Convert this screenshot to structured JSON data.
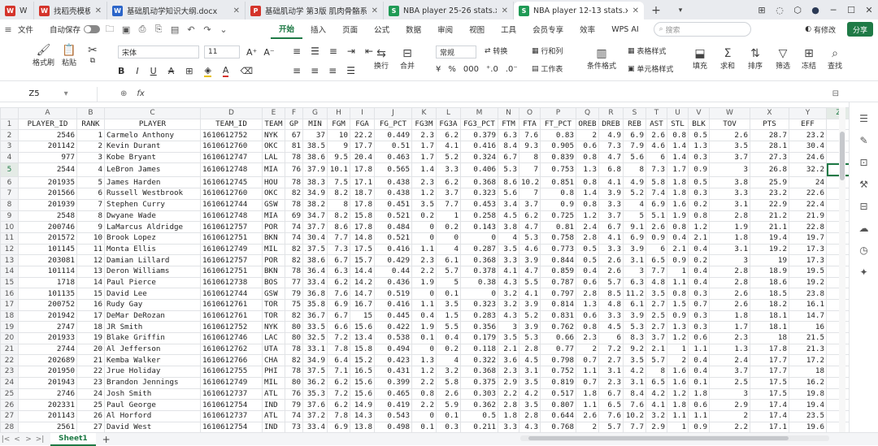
{
  "tabs": [
    {
      "label": "W",
      "color": "#d4342b",
      "icon": "W"
    },
    {
      "label": "找稻壳模板",
      "color": "#d4342b",
      "icon": "W"
    },
    {
      "label": "基础肌动学知识大纲.docx",
      "color": "#2b65c9",
      "icon": "W"
    },
    {
      "label": "基础肌动学 第3版 肌肉骨骼系统结构",
      "color": "#d4342b",
      "icon": "P"
    },
    {
      "label": "NBA player 25-26 stats.xlsx",
      "color": "#1f9a55",
      "icon": "S"
    },
    {
      "label": "NBA player 12-13 stats.xlsx",
      "color": "#1f9a55",
      "icon": "S"
    }
  ],
  "menubar": {
    "file": "文件",
    "autosave": "自动保存",
    "items": [
      "开始",
      "插入",
      "页面",
      "公式",
      "数据",
      "审阅",
      "视图",
      "工具",
      "会员专享",
      "效率",
      "WPS AI"
    ],
    "active": "开始",
    "search_placeholder": "搜索",
    "modify": "有修改",
    "share": "分享"
  },
  "ribbon": {
    "format_painter": "格式刷",
    "paste": "粘贴",
    "font": "宋体",
    "size": "11",
    "wrap": "换行",
    "merge": "合并",
    "number_format": "常规",
    "convert": "转换",
    "rowcol": "行和列",
    "worksheet": "工作表",
    "cond_format": "条件格式",
    "table_style": "表格样式",
    "cell_style": "单元格样式",
    "fill": "填充",
    "sum": "求和",
    "sort": "排序",
    "filter": "筛选",
    "freeze": "冻结",
    "find": "查找"
  },
  "formula": {
    "cell": "Z5",
    "fx": "fx"
  },
  "columns": [
    "A",
    "B",
    "C",
    "D",
    "E",
    "F",
    "G",
    "H",
    "I",
    "J",
    "K",
    "L",
    "M",
    "N",
    "O",
    "P",
    "Q",
    "R",
    "S",
    "T",
    "U",
    "V",
    "W",
    "X",
    "Y",
    "Z"
  ],
  "headers": [
    "PLAYER_ID",
    "RANK",
    "PLAYER",
    "TEAM_ID",
    "TEAM",
    "GP",
    "MIN",
    "FGM",
    "FGA",
    "FG_PCT",
    "FG3M",
    "FG3A",
    "FG3_PCT",
    "FTM",
    "FTA",
    "FT_PCT",
    "OREB",
    "DREB",
    "REB",
    "AST",
    "STL",
    "BLK",
    "TOV",
    "PTS",
    "EFF",
    ""
  ],
  "rows": [
    [
      "2546",
      "1",
      "Carmelo Anthony",
      "1610612752",
      "NYK",
      "67",
      "37",
      "10",
      "22.2",
      "0.449",
      "2.3",
      "6.2",
      "0.379",
      "6.3",
      "7.6",
      "0.83",
      "2",
      "4.9",
      "6.9",
      "2.6",
      "0.8",
      "0.5",
      "2.6",
      "28.7",
      "23.2"
    ],
    [
      "201142",
      "2",
      "Kevin Durant",
      "1610612760",
      "OKC",
      "81",
      "38.5",
      "9",
      "17.7",
      "0.51",
      "1.7",
      "4.1",
      "0.416",
      "8.4",
      "9.3",
      "0.905",
      "0.6",
      "7.3",
      "7.9",
      "4.6",
      "1.4",
      "1.3",
      "3.5",
      "28.1",
      "30.4"
    ],
    [
      "977",
      "3",
      "Kobe Bryant",
      "1610612747",
      "LAL",
      "78",
      "38.6",
      "9.5",
      "20.4",
      "0.463",
      "1.7",
      "5.2",
      "0.324",
      "6.7",
      "8",
      "0.839",
      "0.8",
      "4.7",
      "5.6",
      "6",
      "1.4",
      "0.3",
      "3.7",
      "27.3",
      "24.6"
    ],
    [
      "2544",
      "4",
      "LeBron James",
      "1610612748",
      "MIA",
      "76",
      "37.9",
      "10.1",
      "17.8",
      "0.565",
      "1.4",
      "3.3",
      "0.406",
      "5.3",
      "7",
      "0.753",
      "1.3",
      "6.8",
      "8",
      "7.3",
      "1.7",
      "0.9",
      "3",
      "26.8",
      "32.2"
    ],
    [
      "201935",
      "5",
      "James Harden",
      "1610612745",
      "HOU",
      "78",
      "38.3",
      "7.5",
      "17.1",
      "0.438",
      "2.3",
      "6.2",
      "0.368",
      "8.6",
      "10.2",
      "0.851",
      "0.8",
      "4.1",
      "4.9",
      "5.8",
      "1.8",
      "0.5",
      "3.8",
      "25.9",
      "24"
    ],
    [
      "201566",
      "6",
      "Russell Westbrook",
      "1610612760",
      "OKC",
      "82",
      "34.9",
      "8.2",
      "18.7",
      "0.438",
      "1.2",
      "3.7",
      "0.323",
      "5.6",
      "7",
      "0.8",
      "1.4",
      "3.9",
      "5.2",
      "7.4",
      "1.8",
      "0.3",
      "3.3",
      "23.2",
      "22.6"
    ],
    [
      "201939",
      "7",
      "Stephen Curry",
      "1610612744",
      "GSW",
      "78",
      "38.2",
      "8",
      "17.8",
      "0.451",
      "3.5",
      "7.7",
      "0.453",
      "3.4",
      "3.7",
      "0.9",
      "0.8",
      "3.3",
      "4",
      "6.9",
      "1.6",
      "0.2",
      "3.1",
      "22.9",
      "22.4"
    ],
    [
      "2548",
      "8",
      "Dwyane Wade",
      "1610612748",
      "MIA",
      "69",
      "34.7",
      "8.2",
      "15.8",
      "0.521",
      "0.2",
      "1",
      "0.258",
      "4.5",
      "6.2",
      "0.725",
      "1.2",
      "3.7",
      "5",
      "5.1",
      "1.9",
      "0.8",
      "2.8",
      "21.2",
      "21.9"
    ],
    [
      "200746",
      "9",
      "LaMarcus Aldridge",
      "1610612757",
      "POR",
      "74",
      "37.7",
      "8.6",
      "17.8",
      "0.484",
      "0",
      "0.2",
      "0.143",
      "3.8",
      "4.7",
      "0.81",
      "2.4",
      "6.7",
      "9.1",
      "2.6",
      "0.8",
      "1.2",
      "1.9",
      "21.1",
      "22.8"
    ],
    [
      "201572",
      "10",
      "Brook Lopez",
      "1610612751",
      "BKN",
      "74",
      "30.4",
      "7.7",
      "14.8",
      "0.521",
      "0",
      "0",
      "0",
      "4",
      "5.3",
      "0.758",
      "2.8",
      "4.1",
      "6.9",
      "0.9",
      "0.4",
      "2.1",
      "1.8",
      "19.4",
      "19.7"
    ],
    [
      "101145",
      "11",
      "Monta Ellis",
      "1610612749",
      "MIL",
      "82",
      "37.5",
      "7.3",
      "17.5",
      "0.416",
      "1.1",
      "4",
      "0.287",
      "3.5",
      "4.6",
      "0.773",
      "0.5",
      "3.3",
      "3.9",
      "6",
      "2.1",
      "0.4",
      "3.1",
      "19.2",
      "17.3"
    ],
    [
      "203081",
      "12",
      "Damian Lillard",
      "1610612757",
      "POR",
      "82",
      "38.6",
      "6.7",
      "15.7",
      "0.429",
      "2.3",
      "6.1",
      "0.368",
      "3.3",
      "3.9",
      "0.844",
      "0.5",
      "2.6",
      "3.1",
      "6.5",
      "0.9",
      "0.2",
      "3",
      "19",
      "17.3"
    ],
    [
      "101114",
      "13",
      "Deron Williams",
      "1610612751",
      "BKN",
      "78",
      "36.4",
      "6.3",
      "14.4",
      "0.44",
      "2.2",
      "5.7",
      "0.378",
      "4.1",
      "4.7",
      "0.859",
      "0.4",
      "2.6",
      "3",
      "7.7",
      "1",
      "0.4",
      "2.8",
      "18.9",
      "19.5"
    ],
    [
      "1718",
      "14",
      "Paul Pierce",
      "1610612738",
      "BOS",
      "77",
      "33.4",
      "6.2",
      "14.2",
      "0.436",
      "1.9",
      "5",
      "0.38",
      "4.3",
      "5.5",
      "0.787",
      "0.6",
      "5.7",
      "6.3",
      "4.8",
      "1.1",
      "0.4",
      "2.8",
      "18.6",
      "19.2"
    ],
    [
      "101135",
      "15",
      "David Lee",
      "1610612744",
      "GSW",
      "79",
      "36.8",
      "7.6",
      "14.7",
      "0.519",
      "0",
      "0.1",
      "0",
      "3.2",
      "4.1",
      "0.797",
      "2.8",
      "8.5",
      "11.2",
      "3.5",
      "0.8",
      "0.3",
      "2.6",
      "18.5",
      "23.8"
    ],
    [
      "200752",
      "16",
      "Rudy Gay",
      "1610612761",
      "TOR",
      "75",
      "35.8",
      "6.9",
      "16.7",
      "0.416",
      "1.1",
      "3.5",
      "0.323",
      "3.2",
      "3.9",
      "0.814",
      "1.3",
      "4.8",
      "6.1",
      "2.7",
      "1.5",
      "0.7",
      "2.6",
      "18.2",
      "16.1"
    ],
    [
      "201942",
      "17",
      "DeMar DeRozan",
      "1610612761",
      "TOR",
      "82",
      "36.7",
      "6.7",
      "15",
      "0.445",
      "0.4",
      "1.5",
      "0.283",
      "4.3",
      "5.2",
      "0.831",
      "0.6",
      "3.3",
      "3.9",
      "2.5",
      "0.9",
      "0.3",
      "1.8",
      "18.1",
      "14.7"
    ],
    [
      "2747",
      "18",
      "JR Smith",
      "1610612752",
      "NYK",
      "80",
      "33.5",
      "6.6",
      "15.6",
      "0.422",
      "1.9",
      "5.5",
      "0.356",
      "3",
      "3.9",
      "0.762",
      "0.8",
      "4.5",
      "5.3",
      "2.7",
      "1.3",
      "0.3",
      "1.7",
      "18.1",
      "16"
    ],
    [
      "201933",
      "19",
      "Blake Griffin",
      "1610612746",
      "LAC",
      "80",
      "32.5",
      "7.2",
      "13.4",
      "0.538",
      "0.1",
      "0.4",
      "0.179",
      "3.5",
      "5.3",
      "0.66",
      "2.3",
      "6",
      "8.3",
      "3.7",
      "1.2",
      "0.6",
      "2.3",
      "18",
      "21.5"
    ],
    [
      "2744",
      "20",
      "Al Jefferson",
      "1610612762",
      "UTA",
      "78",
      "33.1",
      "7.8",
      "15.8",
      "0.494",
      "0",
      "0.2",
      "0.118",
      "2.1",
      "2.8",
      "0.77",
      "2",
      "7.2",
      "9.2",
      "2.1",
      "1",
      "1.1",
      "1.3",
      "17.8",
      "21.3"
    ],
    [
      "202689",
      "21",
      "Kemba Walker",
      "1610612766",
      "CHA",
      "82",
      "34.9",
      "6.4",
      "15.2",
      "0.423",
      "1.3",
      "4",
      "0.322",
      "3.6",
      "4.5",
      "0.798",
      "0.7",
      "2.7",
      "3.5",
      "5.7",
      "2",
      "0.4",
      "2.4",
      "17.7",
      "17.2"
    ],
    [
      "201950",
      "22",
      "Jrue Holiday",
      "1610612755",
      "PHI",
      "78",
      "37.5",
      "7.1",
      "16.5",
      "0.431",
      "1.2",
      "3.2",
      "0.368",
      "2.3",
      "3.1",
      "0.752",
      "1.1",
      "3.1",
      "4.2",
      "8",
      "1.6",
      "0.4",
      "3.7",
      "17.7",
      "18"
    ],
    [
      "201943",
      "23",
      "Brandon Jennings",
      "1610612749",
      "MIL",
      "80",
      "36.2",
      "6.2",
      "15.6",
      "0.399",
      "2.2",
      "5.8",
      "0.375",
      "2.9",
      "3.5",
      "0.819",
      "0.7",
      "2.3",
      "3.1",
      "6.5",
      "1.6",
      "0.1",
      "2.5",
      "17.5",
      "16.2"
    ],
    [
      "2746",
      "24",
      "Josh Smith",
      "1610612737",
      "ATL",
      "76",
      "35.3",
      "7.2",
      "15.6",
      "0.465",
      "0.8",
      "2.6",
      "0.303",
      "2.2",
      "4.2",
      "0.517",
      "1.8",
      "6.7",
      "8.4",
      "4.2",
      "1.2",
      "1.8",
      "3",
      "17.5",
      "19.8"
    ],
    [
      "202331",
      "25",
      "Paul George",
      "1610612754",
      "IND",
      "79",
      "37.6",
      "6.2",
      "14.9",
      "0.419",
      "2.2",
      "5.9",
      "0.362",
      "2.8",
      "3.5",
      "0.807",
      "1.1",
      "6.5",
      "7.6",
      "4.1",
      "1.8",
      "0.6",
      "2.9",
      "17.4",
      "19.4"
    ],
    [
      "201143",
      "26",
      "Al Horford",
      "1610612737",
      "ATL",
      "74",
      "37.2",
      "7.8",
      "14.3",
      "0.543",
      "0",
      "0.1",
      "0.5",
      "1.8",
      "2.8",
      "0.644",
      "2.6",
      "7.6",
      "10.2",
      "3.2",
      "1.1",
      "1.1",
      "2",
      "17.4",
      "23.5"
    ],
    [
      "2561",
      "27",
      "David West",
      "1610612754",
      "IND",
      "73",
      "33.4",
      "6.9",
      "13.8",
      "0.498",
      "0.1",
      "0.3",
      "0.211",
      "3.3",
      "4.3",
      "0.768",
      "2",
      "5.7",
      "7.7",
      "2.9",
      "1",
      "0.9",
      "2.2",
      "17.1",
      "19.6"
    ]
  ],
  "bottom": {
    "sheet": "Sheet1",
    "add": "+"
  }
}
